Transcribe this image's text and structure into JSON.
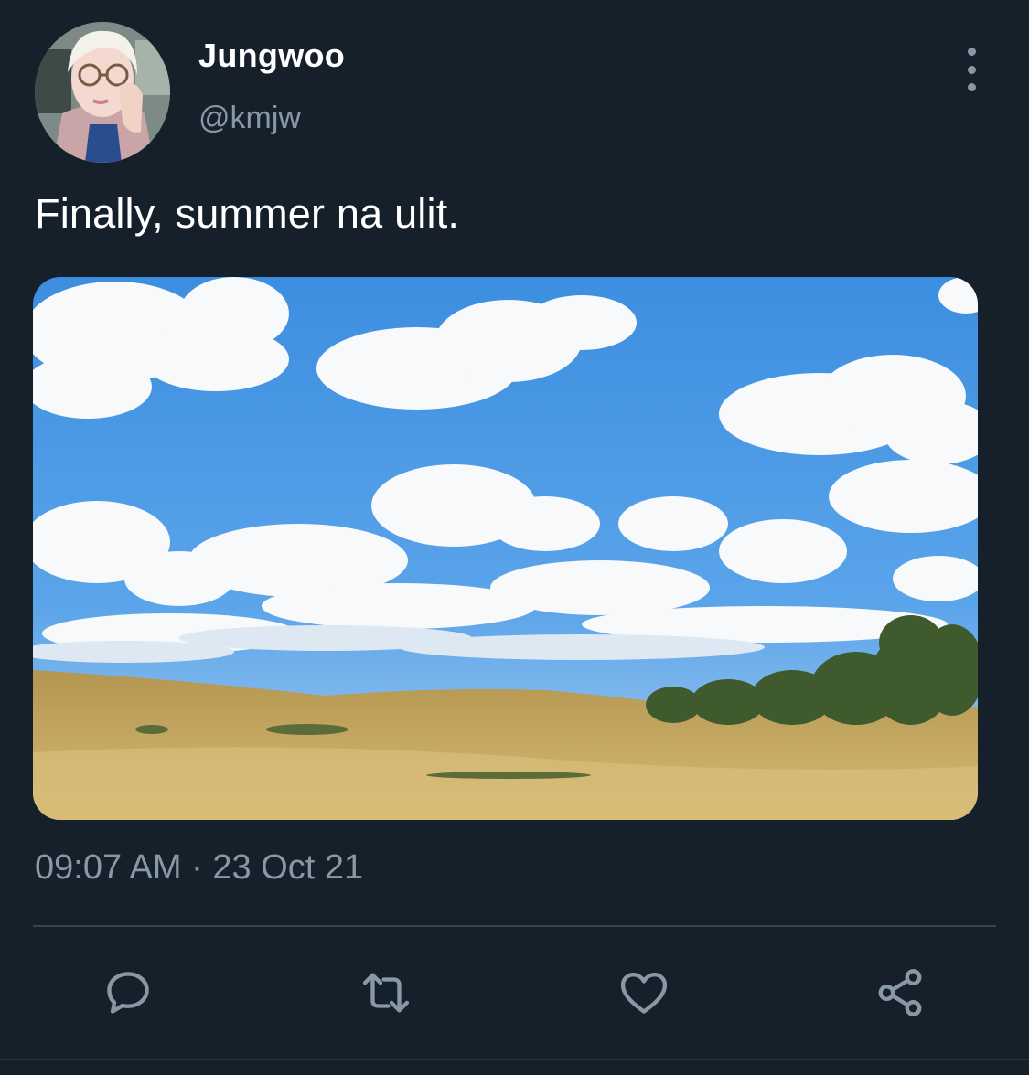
{
  "user": {
    "display_name": "Jungwoo",
    "handle": "@kmjw"
  },
  "tweet": {
    "text": "Finally, summer na ulit.",
    "timestamp": "09:07 AM · 23 Oct 21"
  },
  "icons": {
    "more": "more-vertical-icon",
    "reply": "reply-icon",
    "retweet": "retweet-icon",
    "like": "heart-icon",
    "share": "share-icon"
  },
  "colors": {
    "background": "#15202b",
    "secondary_text": "#8899a6",
    "divider": "#38444d"
  }
}
